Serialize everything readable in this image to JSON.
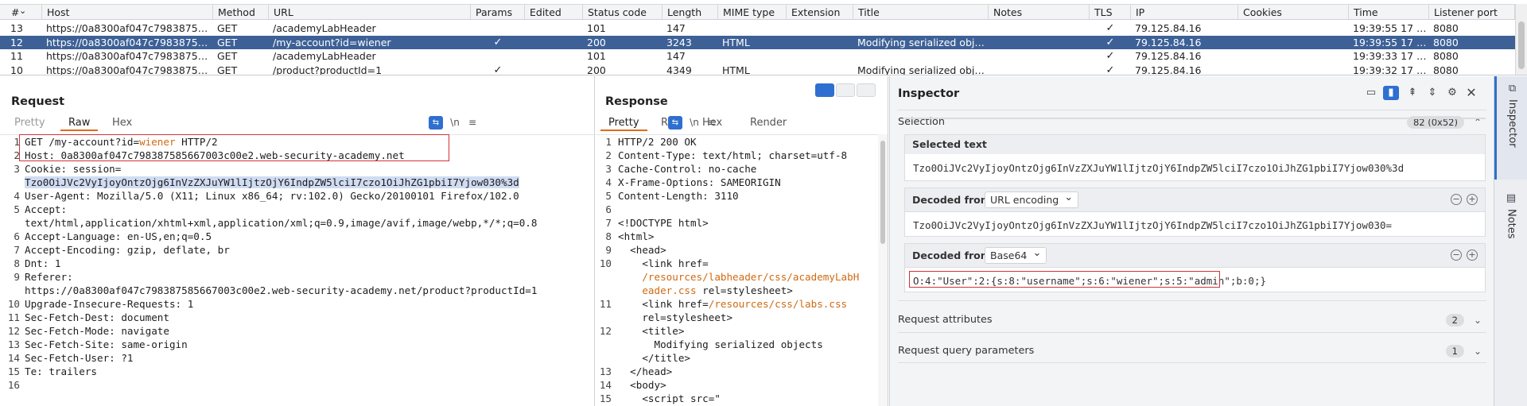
{
  "history": {
    "columns": [
      "#",
      "Host",
      "Method",
      "URL",
      "Params",
      "Edited",
      "Status code",
      "Length",
      "MIME type",
      "Extension",
      "Title",
      "Notes",
      "TLS",
      "IP",
      "Cookies",
      "Time",
      "Listener port"
    ],
    "rows": [
      {
        "num": "13",
        "host": "https://0a8300af047c798387585...",
        "method": "GET",
        "url": "/academyLabHeader",
        "params": "",
        "edited": "",
        "status": "101",
        "length": "147",
        "mime": "",
        "ext": "",
        "title": "",
        "notes": "",
        "tls": "✓",
        "ip": "79.125.84.16",
        "cookies": "",
        "time": "19:39:55 17 Ma...",
        "port": "8080"
      },
      {
        "num": "12",
        "host": "https://0a8300af047c798387585...",
        "method": "GET",
        "url": "/my-account?id=wiener",
        "params": "✓",
        "edited": "",
        "status": "200",
        "length": "3243",
        "mime": "HTML",
        "ext": "",
        "title": "Modifying serialized objects",
        "notes": "",
        "tls": "✓",
        "ip": "79.125.84.16",
        "cookies": "",
        "time": "19:39:55 17 Ma...",
        "port": "8080",
        "selected": true
      },
      {
        "num": "11",
        "host": "https://0a8300af047c798387585...",
        "method": "GET",
        "url": "/academyLabHeader",
        "params": "",
        "edited": "",
        "status": "101",
        "length": "147",
        "mime": "",
        "ext": "",
        "title": "",
        "notes": "",
        "tls": "✓",
        "ip": "79.125.84.16",
        "cookies": "",
        "time": "19:39:33 17 Ma...",
        "port": "8080"
      },
      {
        "num": "10",
        "host": "https://0a8300af047c798387585...",
        "method": "GET",
        "url": "/product?productId=1",
        "params": "✓",
        "edited": "",
        "status": "200",
        "length": "4349",
        "mime": "HTML",
        "ext": "",
        "title": "Modifying serialized objects",
        "notes": "",
        "tls": "✓",
        "ip": "79.125.84.16",
        "cookies": "",
        "time": "19:39:32 17 Ma...",
        "port": "8080"
      }
    ]
  },
  "request": {
    "title": "Request",
    "tabs": [
      "Pretty",
      "Raw",
      "Hex"
    ],
    "active_tab": "Raw",
    "wrap_icon": "⇆",
    "newline_label": "\\n",
    "menu_icon": "≡",
    "lines": [
      {
        "n": "1",
        "parts": [
          {
            "t": "GET /my-account?id="
          },
          {
            "t": "wiener",
            "c": "accent"
          },
          {
            "t": " HTTP/2"
          }
        ]
      },
      {
        "n": "2",
        "parts": [
          {
            "t": "Host: 0a8300af047c798387585667003c00e2.web-security-academy.net"
          }
        ]
      },
      {
        "n": "3",
        "parts": [
          {
            "t": "Cookie: session="
          }
        ]
      },
      {
        "n": "",
        "parts": [
          {
            "t": "Tzo0OiJVc2VyIjoyOntzOjg6InVzZXJuYW1lIjtzOjY6IndpZW5lciI7czo1OiJhZG1pbiI7Yjow030%3d",
            "c": "selbg"
          }
        ]
      },
      {
        "n": "4",
        "parts": [
          {
            "t": "User-Agent: Mozilla/5.0 (X11; Linux x86_64; rv:102.0) Gecko/20100101 Firefox/102.0"
          }
        ]
      },
      {
        "n": "5",
        "parts": [
          {
            "t": "Accept:"
          }
        ]
      },
      {
        "n": "",
        "parts": [
          {
            "t": "text/html,application/xhtml+xml,application/xml;q=0.9,image/avif,image/webp,*/*;q=0.8"
          }
        ]
      },
      {
        "n": "6",
        "parts": [
          {
            "t": "Accept-Language: en-US,en;q=0.5"
          }
        ]
      },
      {
        "n": "7",
        "parts": [
          {
            "t": "Accept-Encoding: gzip, deflate, br"
          }
        ]
      },
      {
        "n": "8",
        "parts": [
          {
            "t": "Dnt: 1"
          }
        ]
      },
      {
        "n": "9",
        "parts": [
          {
            "t": "Referer:"
          }
        ]
      },
      {
        "n": "",
        "parts": [
          {
            "t": "https://0a8300af047c798387585667003c00e2.web-security-academy.net/product?productId=1"
          }
        ]
      },
      {
        "n": "10",
        "parts": [
          {
            "t": "Upgrade-Insecure-Requests: 1"
          }
        ]
      },
      {
        "n": "11",
        "parts": [
          {
            "t": "Sec-Fetch-Dest: document"
          }
        ]
      },
      {
        "n": "12",
        "parts": [
          {
            "t": "Sec-Fetch-Mode: navigate"
          }
        ]
      },
      {
        "n": "13",
        "parts": [
          {
            "t": "Sec-Fetch-Site: same-origin"
          }
        ]
      },
      {
        "n": "14",
        "parts": [
          {
            "t": "Sec-Fetch-User: ?1"
          }
        ]
      },
      {
        "n": "15",
        "parts": [
          {
            "t": "Te: trailers"
          }
        ]
      },
      {
        "n": "16",
        "parts": [
          {
            "t": ""
          }
        ]
      }
    ]
  },
  "response": {
    "title": "Response",
    "tabs": [
      "Pretty",
      "Raw",
      "Hex",
      "Render"
    ],
    "active_tab": "Pretty",
    "lines": [
      {
        "n": "1",
        "parts": [
          {
            "t": "HTTP/2 200 OK"
          }
        ]
      },
      {
        "n": "2",
        "parts": [
          {
            "t": "Content-Type: text/html; charset=utf-8"
          }
        ]
      },
      {
        "n": "3",
        "parts": [
          {
            "t": "Cache-Control: no-cache"
          }
        ]
      },
      {
        "n": "4",
        "parts": [
          {
            "t": "X-Frame-Options: SAMEORIGIN"
          }
        ]
      },
      {
        "n": "5",
        "parts": [
          {
            "t": "Content-Length: 3110"
          }
        ]
      },
      {
        "n": "6",
        "parts": [
          {
            "t": ""
          }
        ]
      },
      {
        "n": "7",
        "parts": [
          {
            "t": "<!DOCTYPE html>"
          }
        ]
      },
      {
        "n": "8",
        "parts": [
          {
            "t": "<html>"
          }
        ]
      },
      {
        "n": "9",
        "parts": [
          {
            "t": "  <head>"
          }
        ]
      },
      {
        "n": "10",
        "parts": [
          {
            "t": "    <link href="
          }
        ]
      },
      {
        "n": "",
        "parts": [
          {
            "t": "    /resources/labheader/css/academyLabH",
            "c": "accent"
          }
        ]
      },
      {
        "n": "",
        "parts": [
          {
            "t": "    eader.css",
            "c": "accent"
          },
          {
            "t": " rel=stylesheet>"
          }
        ]
      },
      {
        "n": "11",
        "parts": [
          {
            "t": "    <link href="
          },
          {
            "t": "/resources/css/labs.css",
            "c": "accent"
          }
        ]
      },
      {
        "n": "",
        "parts": [
          {
            "t": "    rel=stylesheet>"
          }
        ]
      },
      {
        "n": "12",
        "parts": [
          {
            "t": "    <title>"
          }
        ]
      },
      {
        "n": "",
        "parts": [
          {
            "t": "      Modifying serialized objects"
          }
        ]
      },
      {
        "n": "",
        "parts": [
          {
            "t": "    </title>"
          }
        ]
      },
      {
        "n": "13",
        "parts": [
          {
            "t": "  </head>"
          }
        ]
      },
      {
        "n": "14",
        "parts": [
          {
            "t": "  <body>"
          }
        ]
      },
      {
        "n": "15",
        "parts": [
          {
            "t": "    <script src=\""
          }
        ]
      }
    ]
  },
  "inspector": {
    "title": "Inspector",
    "selection_label": "Selection",
    "selection_badge": "82 (0x52)",
    "selected_text_label": "Selected text",
    "selected_text": "Tzo0OiJVc2VyIjoyOntzOjg6InVzZXJuYW1lIjtzOjY6IndpZW5lciI7czo1OiJhZG1pbiI7Yjow030%3d",
    "decoded1_label": "Decoded from:",
    "decoded1_type": "URL encoding",
    "decoded1_value": "Tzo0OiJVc2VyIjoyOntzOjg6InVzZXJuYW1lIjtzOjY6IndpZW5lciI7czo1OiJhZG1pbiI7Yjow030=",
    "decoded2_label": "Decoded from:",
    "decoded2_type": "Base64",
    "decoded2_value": "O:4:\"User\":2:{s:8:\"username\";s:6:\"wiener\";s:5:\"admin\";b:0;}",
    "req_attr_label": "Request attributes",
    "req_attr_count": "2",
    "req_query_label": "Request query parameters",
    "req_query_count": "1"
  },
  "rail": {
    "inspector": "Inspector",
    "notes": "Notes"
  },
  "colors": {
    "accent": "#e06b1a",
    "selection": "#3d6197",
    "brand_blue": "#2f6fd0",
    "highlight_box": "#d0343a"
  }
}
